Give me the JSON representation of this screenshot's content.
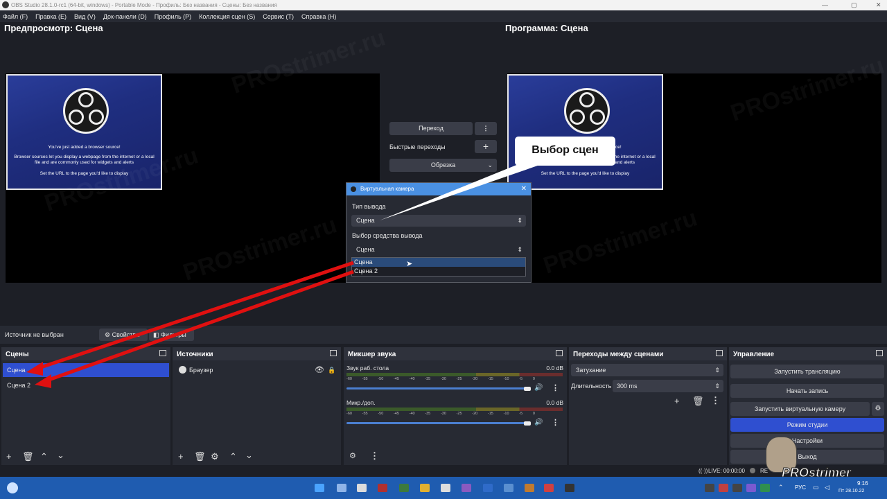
{
  "window": {
    "title": "OBS Studio 28.1.0-rc1 (64-bit, windows) - Portable Mode - Профиль: Без названия - Сцены: Без названия"
  },
  "menu": [
    "Файл (F)",
    "Правка (E)",
    "Вид (V)",
    "Док-панели (D)",
    "Профиль (P)",
    "Коллекция сцен (S)",
    "Сервис (T)",
    "Справка (H)"
  ],
  "preview": {
    "label": "Предпросмотр: Сцена"
  },
  "program": {
    "label": "Программа: Сцена"
  },
  "browser_source": {
    "line1": "You've just added a browser source!",
    "line2": "Browser sources let you display a webpage from the internet or a local file and are commonly used for widgets and alerts",
    "line3": "Set the URL to the page you'd like to display"
  },
  "transition_panel": {
    "transition_btn": "Переход",
    "quick_label": "Быстрые переходы",
    "crop_select": "Обрезка"
  },
  "callout": {
    "text": "Выбор сцен"
  },
  "dialog": {
    "title": "Виртуальная камера",
    "output_type_label": "Тип вывода",
    "output_type_value": "Сцена",
    "output_select_label": "Выбор средства вывода",
    "output_select_value": "Сцена",
    "options": [
      "Сцена",
      "Сцена 2"
    ]
  },
  "source_bar": {
    "status": "Источник не выбран",
    "props": "Свойства",
    "filters": "Фильтры"
  },
  "scenes": {
    "title": "Сцены",
    "items": [
      "Сцена",
      "Сцена 2"
    ]
  },
  "sources": {
    "title": "Источники",
    "items": [
      "Браузер"
    ]
  },
  "mixer": {
    "title": "Микшер звука",
    "scale": [
      "-60",
      "-55",
      "-50",
      "-45",
      "-40",
      "-35",
      "-30",
      "-25",
      "-20",
      "-15",
      "-10",
      "-5",
      "0"
    ],
    "channels": [
      {
        "name": "Звук раб. стола",
        "db": "0.0 dB"
      },
      {
        "name": "Микр./доп.",
        "db": "0.0 dB"
      }
    ]
  },
  "transitions": {
    "title": "Переходы между сценами",
    "type": "Затухание",
    "duration_label": "Длительность",
    "duration_value": "300 ms"
  },
  "controls": {
    "title": "Управление",
    "start_stream": "Запустить трансляцию",
    "start_record": "Начать запись",
    "virtual_cam": "Запустить виртуальную камеру",
    "studio_mode": "Режим студии",
    "settings": "Настройки",
    "exit": "Выход"
  },
  "statusbar": {
    "live": "LIVE: 00:00:00",
    "rec": "RE"
  },
  "watermark": {
    "text": "PROstrimer.ru",
    "logo": "PROstrimer"
  },
  "taskbar": {
    "lang": "РУС",
    "time": "9:16",
    "date": "Пт 28.10.22"
  },
  "colors": {
    "accent": "#2f4fd0",
    "arrow": "#e01010",
    "dialog_title": "#4a90e2"
  }
}
